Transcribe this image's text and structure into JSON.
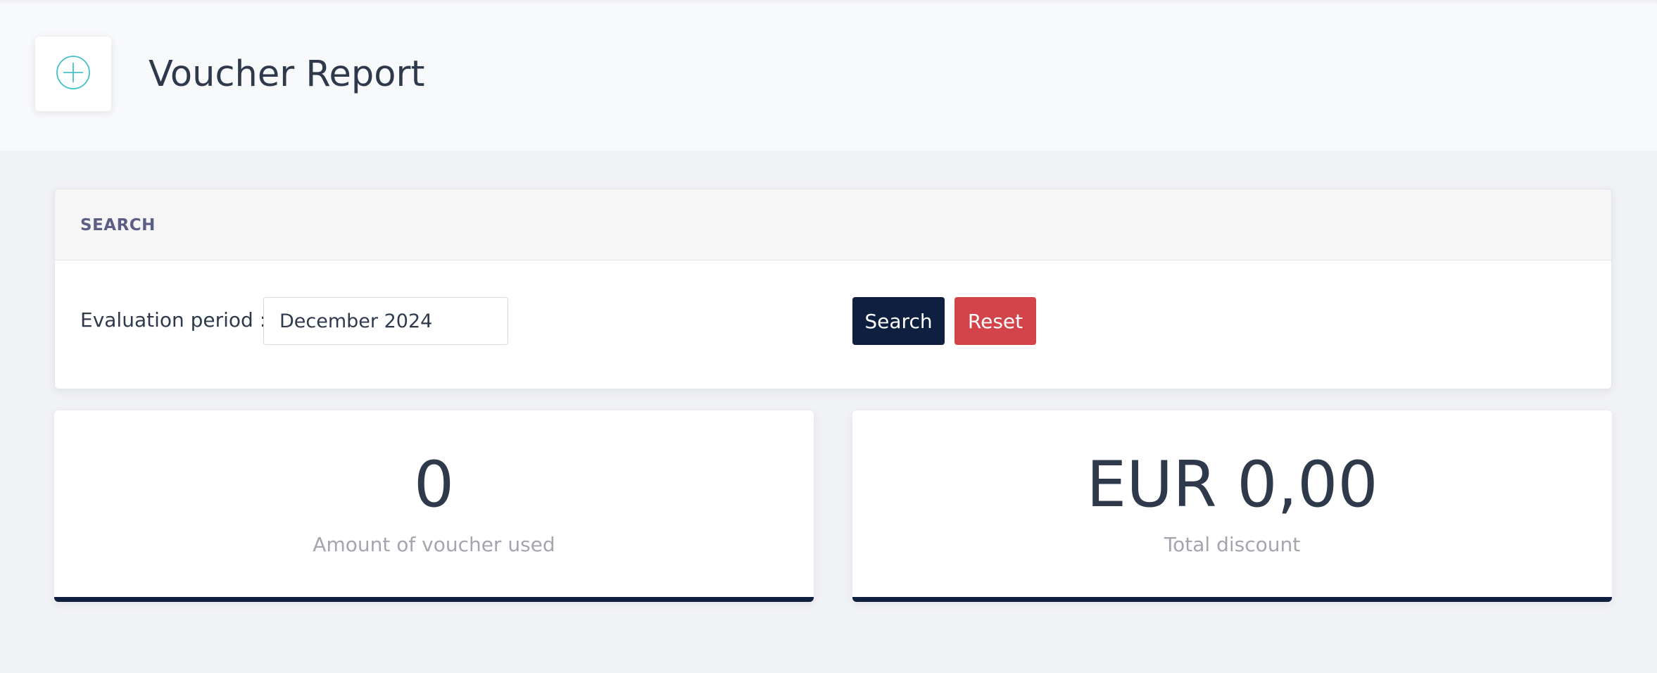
{
  "header": {
    "title": "Voucher Report",
    "icon": "plus-circle-icon",
    "icon_color": "#46c2c6"
  },
  "search": {
    "heading": "SEARCH",
    "period_label": "Evaluation period :",
    "period_value": "December 2024",
    "search_button": "Search",
    "reset_button": "Reset",
    "search_button_color": "#0f1f3f",
    "reset_button_color": "#d2434a"
  },
  "stats": [
    {
      "value": "0",
      "caption": "Amount of voucher used"
    },
    {
      "value": "EUR 0,00",
      "caption": "Total discount"
    }
  ]
}
